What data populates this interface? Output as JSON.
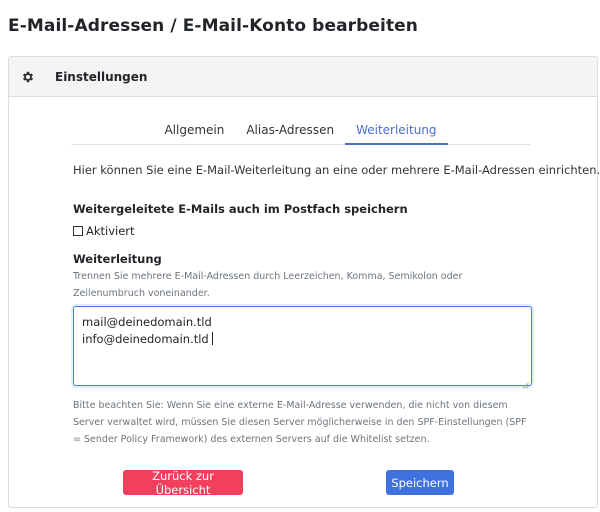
{
  "page": {
    "title": "E-Mail-Adressen / E-Mail-Konto bearbeiten"
  },
  "card": {
    "header_title": "Einstellungen",
    "header_icon": "gear-icon"
  },
  "tabs": [
    {
      "label": "Allgemein",
      "active": false
    },
    {
      "label": "Alias-Adressen",
      "active": false
    },
    {
      "label": "Weiterleitung",
      "active": true
    }
  ],
  "intro_text": "Hier können Sie eine E-Mail-Weiterleitung an eine oder mehrere E-Mail-Adressen einrichten.",
  "store_copy": {
    "title": "Weitergeleitete E-Mails auch im Postfach speichern",
    "checkbox_label": "Aktiviert",
    "checked": false
  },
  "forwarding": {
    "title": "Weiterleitung",
    "help": "Trennen Sie mehrere E-Mail-Adressen durch Leerzeichen, Komma, Semikolon oder Zeilenumbruch voneinander.",
    "lines": [
      "mail@deinedomain.tld",
      "info@deinedomain.tld"
    ]
  },
  "notice": "Bitte beachten Sie: Wenn Sie eine externe E-Mail-Adresse verwenden, die nicht von diesem Server verwaltet wird, müssen Sie diesen Server möglicherweise in den SPF-Einstellungen (SPF = Sender Policy Framework) des externen Servers auf die Whitelist setzen.",
  "buttons": {
    "back_label": "Zurück zur Übersicht",
    "save_label": "Speichern"
  },
  "colors": {
    "accent": "#4a6fd1",
    "danger": "#f0405d",
    "primary": "#3f72e0"
  }
}
